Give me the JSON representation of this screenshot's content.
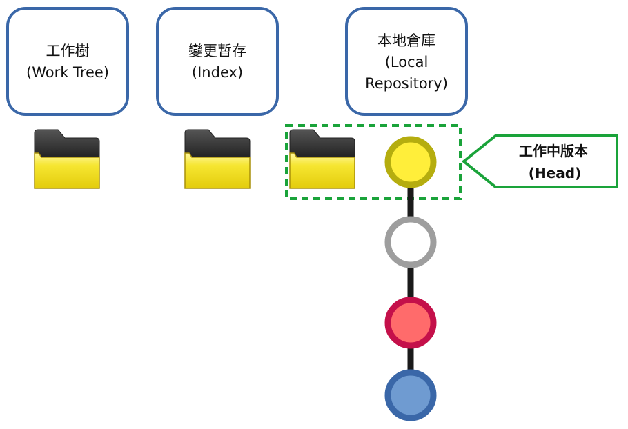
{
  "areas": [
    {
      "lines": [
        "工作樹",
        "(Work Tree)"
      ]
    },
    {
      "lines": [
        "變更暫存",
        "(Index)"
      ]
    },
    {
      "lines": [
        "本地倉庫",
        "(Local",
        "Repository)"
      ]
    }
  ],
  "head_callout": {
    "lines": [
      "工作中版本",
      "(Head)"
    ]
  },
  "colors": {
    "box_border": "#3a67a8",
    "selection_border": "#1aa33a",
    "callout_border": "#1aa33a",
    "folder_back": "#3a3a3a",
    "folder_front": "#f2e01e",
    "connector": "#1a1a1a"
  },
  "commits": [
    {
      "fill": "#ffee3a",
      "stroke": "#b5ad0f",
      "role": "head"
    },
    {
      "fill": "#ffffff",
      "stroke": "#9e9e9e"
    },
    {
      "fill": "#ff6b6b",
      "stroke": "#c4104a"
    },
    {
      "fill": "#6f9bd1",
      "stroke": "#3a67a8"
    }
  ]
}
